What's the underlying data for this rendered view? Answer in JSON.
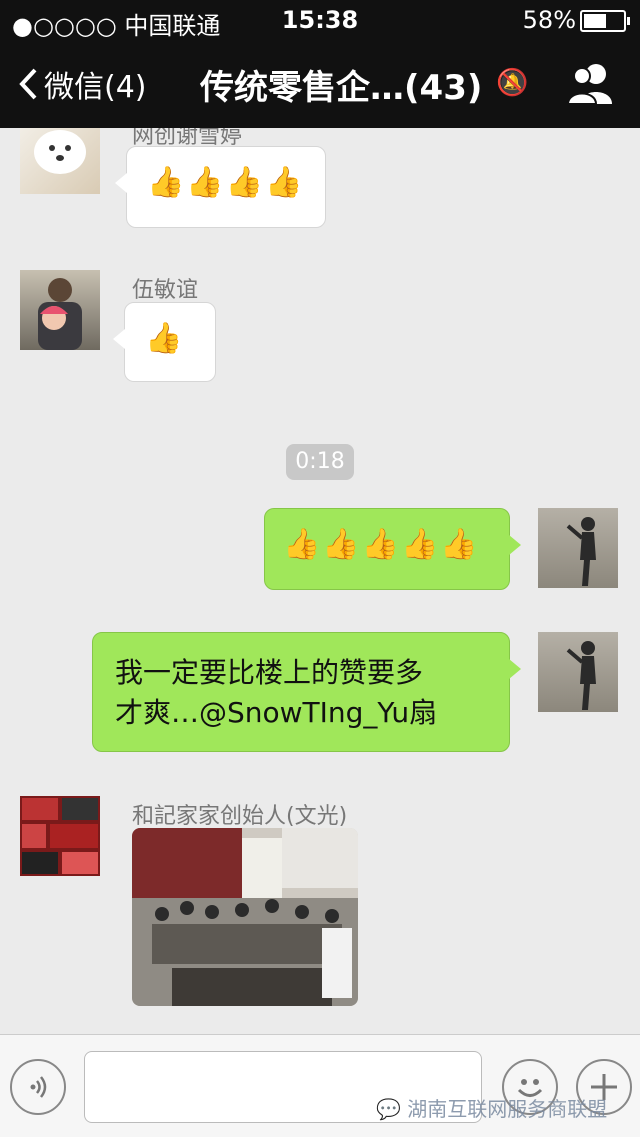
{
  "status_bar": {
    "carrier": "●○○○○ 中国联通",
    "time": "15:38",
    "battery": "58%",
    "battery_level": 0.58
  },
  "nav": {
    "back_label": "微信(4)",
    "title": "传统零售企…(43)"
  },
  "messages": [
    {
      "sender": "网创谢雪婷",
      "emoji": "👍👍👍👍"
    },
    {
      "sender": "伍敏谊",
      "emoji": "👍"
    },
    {
      "timestamp": "0:18"
    },
    {
      "emoji": "👍👍👍👍👍"
    },
    {
      "text_line1": "我一定要比楼上的赞要多",
      "text_line2": "才爽…@SnowTIng_Yu扇"
    },
    {
      "sender": "和記家家创始人(文光)"
    }
  ],
  "watermark": "湖南互联网服务商联盟",
  "colors": {
    "accent_green": "#a0e75a",
    "nav_bg": "#111111",
    "chat_bg": "#ebebeb"
  }
}
